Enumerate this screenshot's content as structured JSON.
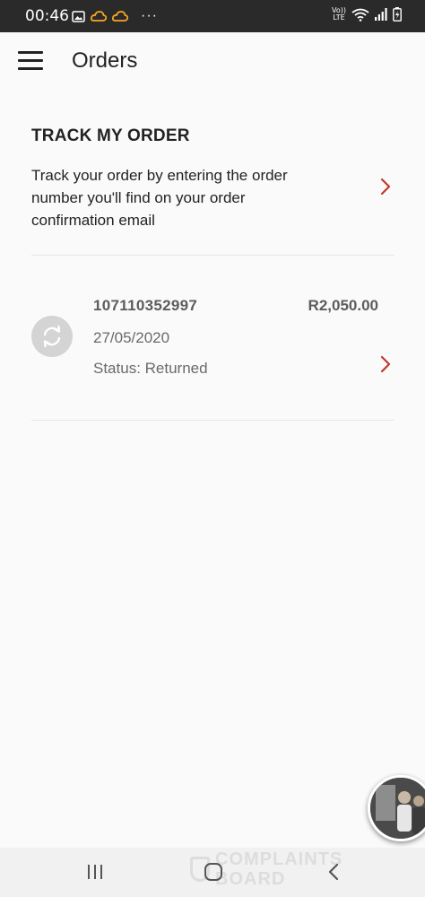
{
  "status_bar": {
    "time": "00:46",
    "dots": "···",
    "volte_top": "Vo))",
    "volte_bottom": "LTE",
    "icons_left": [
      "image-icon",
      "cloud-icon",
      "cloud-icon"
    ],
    "icons_right": [
      "volte-icon",
      "wifi-icon",
      "signal-icon",
      "battery-icon"
    ]
  },
  "app_bar": {
    "menu_icon": "hamburger-menu-icon",
    "title": "Orders"
  },
  "track_section": {
    "heading": "TRACK MY ORDER",
    "description": "Track your order by entering the order number you'll find on your order confirmation email",
    "chevron_icon": "chevron-right-icon"
  },
  "orders": [
    {
      "icon": "refresh-icon",
      "number": "107110352997",
      "amount": "R2,050.00",
      "date": "27/05/2020",
      "status": "Status: Returned",
      "chevron_icon": "chevron-right-icon"
    }
  ],
  "chat_bubble": {
    "icon": "chat-head-avatar"
  },
  "watermark": {
    "line1": "COMPLAINTS",
    "line2": "BOARD"
  },
  "nav_bar": {
    "icons": [
      "recent-apps-icon",
      "home-icon",
      "back-icon"
    ]
  },
  "colors": {
    "accent": "#c0392b",
    "status_bar_bg": "#2a2a2a",
    "page_bg": "#fafafa",
    "text_primary": "#222222",
    "text_secondary": "#6a6a6a"
  }
}
